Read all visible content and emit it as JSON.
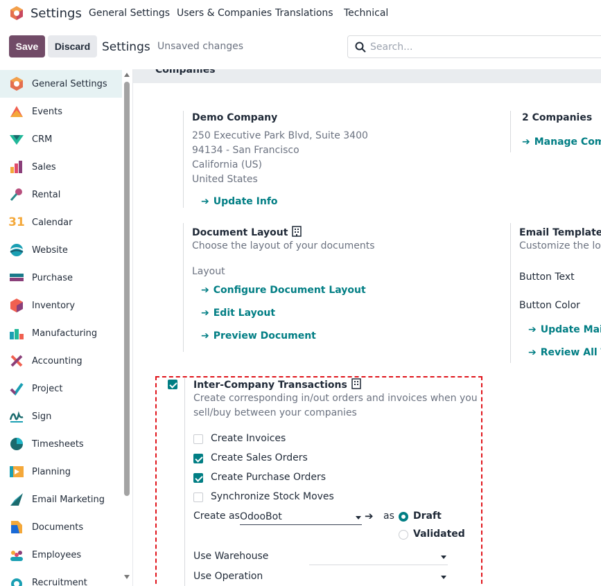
{
  "topbar": {
    "app_name": "Settings",
    "menu": [
      "General Settings",
      "Users & Companies",
      "Translations",
      "Technical"
    ]
  },
  "control_panel": {
    "save_label": "Save",
    "discard_label": "Discard",
    "title": "Settings",
    "status": "Unsaved changes",
    "search_placeholder": "Search..."
  },
  "sidebar": {
    "items": [
      {
        "label": "General Settings",
        "icon": "general-settings-icon",
        "active": true
      },
      {
        "label": "Events",
        "icon": "events-icon"
      },
      {
        "label": "CRM",
        "icon": "crm-icon"
      },
      {
        "label": "Sales",
        "icon": "sales-icon"
      },
      {
        "label": "Rental",
        "icon": "rental-icon"
      },
      {
        "label": "Calendar",
        "icon": "calendar-icon"
      },
      {
        "label": "Website",
        "icon": "website-icon"
      },
      {
        "label": "Purchase",
        "icon": "purchase-icon"
      },
      {
        "label": "Inventory",
        "icon": "inventory-icon"
      },
      {
        "label": "Manufacturing",
        "icon": "manufacturing-icon"
      },
      {
        "label": "Accounting",
        "icon": "accounting-icon"
      },
      {
        "label": "Project",
        "icon": "project-icon"
      },
      {
        "label": "Sign",
        "icon": "sign-icon"
      },
      {
        "label": "Timesheets",
        "icon": "timesheets-icon"
      },
      {
        "label": "Planning",
        "icon": "planning-icon"
      },
      {
        "label": "Email Marketing",
        "icon": "email-marketing-icon"
      },
      {
        "label": "Documents",
        "icon": "documents-icon"
      },
      {
        "label": "Employees",
        "icon": "employees-icon"
      },
      {
        "label": "Recruitment",
        "icon": "recruitment-icon"
      }
    ],
    "calendar_icon_text": "31"
  },
  "companies_section": {
    "title": "Companies",
    "company": {
      "name": "Demo Company",
      "address_lines": [
        "250 Executive Park Blvd, Suite 3400",
        "94134 - San Francisco",
        "California (US)",
        "United States"
      ],
      "update_link": "Update Info"
    },
    "multi": {
      "count_label": "2 Companies",
      "manage_link": "Manage Compa"
    },
    "document_layout": {
      "title": "Document Layout",
      "description": "Choose the layout of your documents",
      "layout_label": "Layout",
      "links": [
        "Configure Document Layout",
        "Edit Layout",
        "Preview Document"
      ]
    },
    "email_templates": {
      "title": "Email Templates",
      "description": "Customize the look",
      "button_text_label": "Button Text",
      "button_color_label": "Button Color",
      "links": [
        "Update Mail L",
        "Review All Te"
      ]
    },
    "inter_company": {
      "title": "Inter-Company Transactions",
      "enabled": true,
      "description_lines": [
        "Create corresponding in/out orders and invoices when you",
        "sell/buy between your companies"
      ],
      "options": [
        {
          "label": "Create Invoices",
          "checked": false
        },
        {
          "label": "Create Sales Orders",
          "checked": true
        },
        {
          "label": "Create Purchase Orders",
          "checked": true
        },
        {
          "label": "Synchronize Stock Moves",
          "checked": false
        }
      ],
      "create_as_label": "Create as",
      "create_as_value": "OdooBot",
      "as_label": "as",
      "states": [
        {
          "label": "Draft",
          "selected": true
        },
        {
          "label": "Validated",
          "selected": false
        }
      ],
      "warehouse_label": "Use Warehouse",
      "warehouse_value": "",
      "operation_label": "Use Operation",
      "operation_value": ""
    }
  },
  "colors": {
    "brand": "#714b67",
    "accent": "#017e84",
    "highlight_border": "#e0131a"
  }
}
